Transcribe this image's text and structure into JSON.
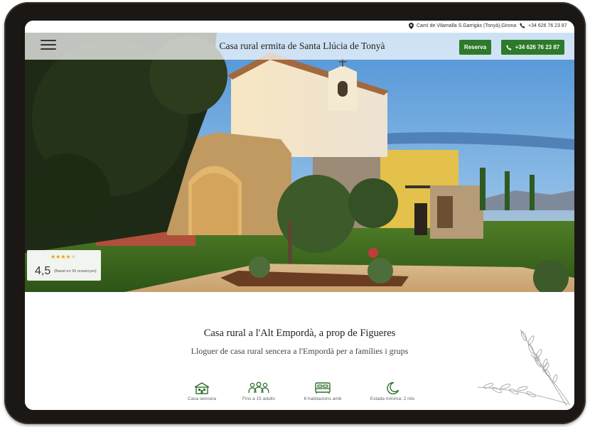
{
  "topbar": {
    "address": "Camí de Vilamalla S.Garrigàs (Tonyà),Girona",
    "phone": "+34 626 76 23 87"
  },
  "header": {
    "title": "Casa rural ermita de Santa Llúcia de Tonyà",
    "reserve_label": "Reserva",
    "phone_button_label": "+34 626 76 23 87"
  },
  "rating": {
    "stars": 4.5,
    "score": "4,5",
    "reviews": "(Basat en 56 ressenyes)"
  },
  "main": {
    "headline": "Casa rural a l'Alt Empordà, a prop de Figueres",
    "subline": "Lloguer de casa rural sencera a l'Empordà per a famílies i grups",
    "features": [
      {
        "icon": "house-icon",
        "label": "Casa sencera"
      },
      {
        "icon": "people-icon",
        "label": "Fins a 15 adults"
      },
      {
        "icon": "bed-icon",
        "label": "6 habitacions amb"
      },
      {
        "icon": "moon-icon",
        "label": "Estada mínima: 2 nits"
      }
    ]
  },
  "colors": {
    "brand_green": "#2d7a2a",
    "icon_green": "#2f6f2c",
    "star": "#e6a400"
  }
}
